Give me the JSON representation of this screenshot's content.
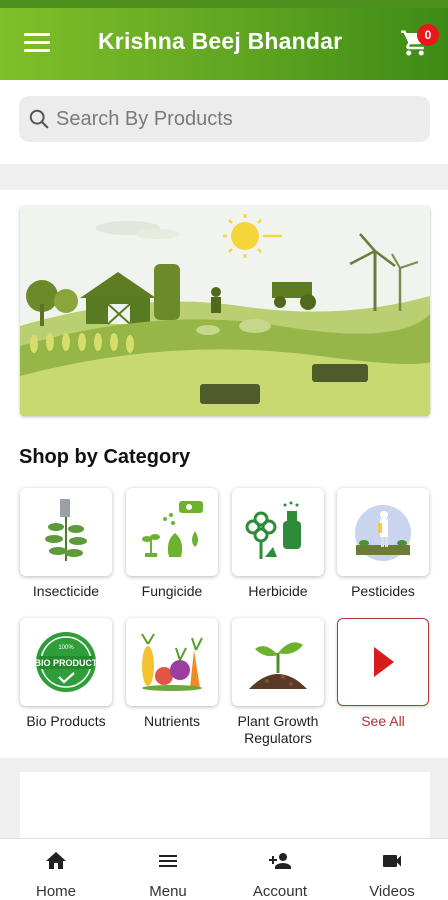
{
  "header": {
    "title": "Krishna Beej Bhandar",
    "cart_count": "0"
  },
  "search": {
    "placeholder": "Search By Products"
  },
  "section": {
    "title": "Shop by Category"
  },
  "categories": [
    {
      "label": "Insecticide",
      "icon": "insecticide-plant-icon"
    },
    {
      "label": "Fungicide",
      "icon": "fungicide-icon"
    },
    {
      "label": "Herbicide",
      "icon": "herbicide-icon"
    },
    {
      "label": "Pesticides",
      "icon": "pesticides-icon"
    },
    {
      "label": "Bio Products",
      "icon": "bio-products-icon"
    },
    {
      "label": "Nutrients",
      "icon": "nutrients-icon"
    },
    {
      "label": "Plant Growth Regulators",
      "icon": "plant-growth-icon"
    },
    {
      "label": "See All",
      "icon": "play-arrow-icon"
    }
  ],
  "bottom_nav": [
    {
      "label": "Home",
      "icon": "home-icon"
    },
    {
      "label": "Menu",
      "icon": "menu-icon"
    },
    {
      "label": "Account",
      "icon": "add-person-icon"
    },
    {
      "label": "Videos",
      "icon": "video-camera-icon"
    }
  ],
  "colors": {
    "brand_green": "#5fa521",
    "badge_red": "#e8171d",
    "see_all_red": "#b03030"
  }
}
